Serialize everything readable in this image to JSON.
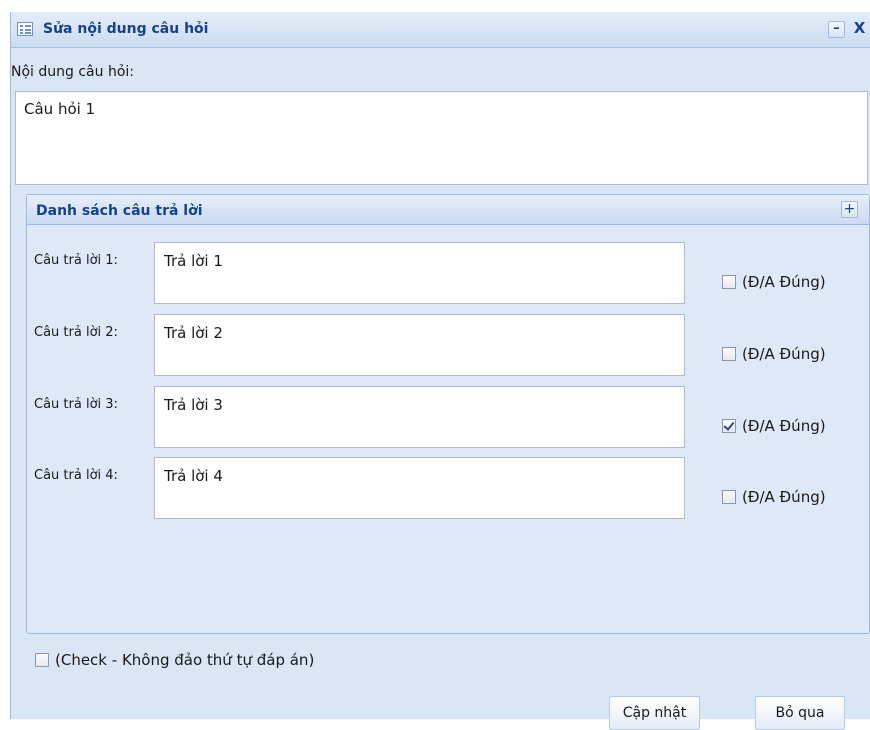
{
  "window": {
    "title": "Sửa nội dung câu hỏi",
    "minimize_glyph": "–",
    "close_glyph": "X"
  },
  "question": {
    "label": "Nội dung câu hỏi:",
    "value": "Câu hỏi 1"
  },
  "answers_panel": {
    "title": "Danh sách câu trả lời",
    "add_glyph": "+",
    "items": [
      {
        "label": "Câu trả lời 1:",
        "value": "Trả lời 1",
        "correct_label": "(Đ/A Đúng)",
        "checked": false
      },
      {
        "label": "Câu trả lời 2:",
        "value": "Trả lời 2",
        "correct_label": "(Đ/A Đúng)",
        "checked": false
      },
      {
        "label": "Câu trả lời 3:",
        "value": "Trả lời 3",
        "correct_label": "(Đ/A Đúng)",
        "checked": true
      },
      {
        "label": "Câu trả lời 4:",
        "value": "Trả lời 4",
        "correct_label": "(Đ/A Đúng)",
        "checked": false
      }
    ]
  },
  "options": {
    "no_shuffle_label": "(Check - Không đảo thứ tự đáp án)",
    "no_shuffle_checked": false
  },
  "footer": {
    "update_label": "Cập nhật",
    "cancel_label": "Bỏ qua"
  },
  "icons": {
    "window": "form-icon",
    "minimize": "minimize-icon",
    "close": "close-icon",
    "add": "plus-icon",
    "checkbox": "checkbox-icon"
  }
}
